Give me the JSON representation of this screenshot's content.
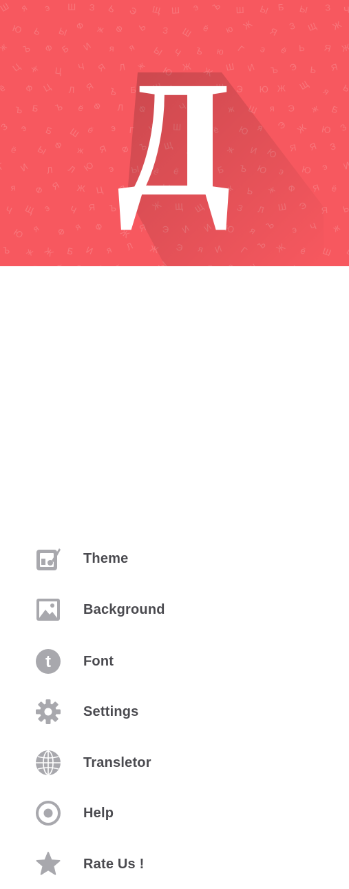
{
  "header": {
    "logo_letter": "Д",
    "bg_color": "#f7585f",
    "logo_color": "#ffffff"
  },
  "menu": {
    "icon_color": "#a8a8ad",
    "items": [
      {
        "label": "Theme",
        "icon": "theme-icon"
      },
      {
        "label": "Background",
        "icon": "image-icon"
      },
      {
        "label": "Font",
        "icon": "font-icon"
      },
      {
        "label": "Settings",
        "icon": "gear-icon"
      },
      {
        "label": "Transletor",
        "icon": "globe-icon"
      },
      {
        "label": "Help",
        "icon": "help-icon"
      },
      {
        "label": "Rate Us !",
        "icon": "star-icon"
      }
    ]
  }
}
